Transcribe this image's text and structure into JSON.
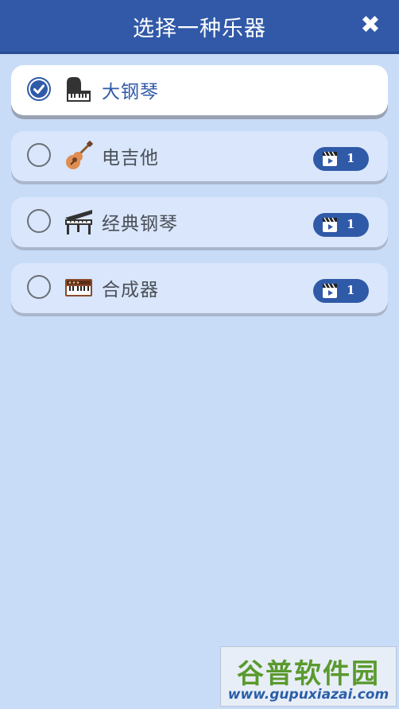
{
  "header": {
    "title": "选择一种乐器",
    "close_icon": "close-icon"
  },
  "instruments": [
    {
      "label": "大钢琴",
      "icon": "grand-piano-icon",
      "selected": true,
      "badge": null
    },
    {
      "label": "电吉他",
      "icon": "guitar-icon",
      "selected": false,
      "badge": "1"
    },
    {
      "label": "经典钢琴",
      "icon": "classic-piano-icon",
      "selected": false,
      "badge": "1"
    },
    {
      "label": "合成器",
      "icon": "synthesizer-icon",
      "selected": false,
      "badge": "1"
    }
  ],
  "watermark": {
    "top": "谷普软件园",
    "bottom": "www.gupuxiazai.com"
  },
  "colors": {
    "header": "#3159a8",
    "background": "#c9dcf7",
    "accent": "#2f5aa8"
  }
}
